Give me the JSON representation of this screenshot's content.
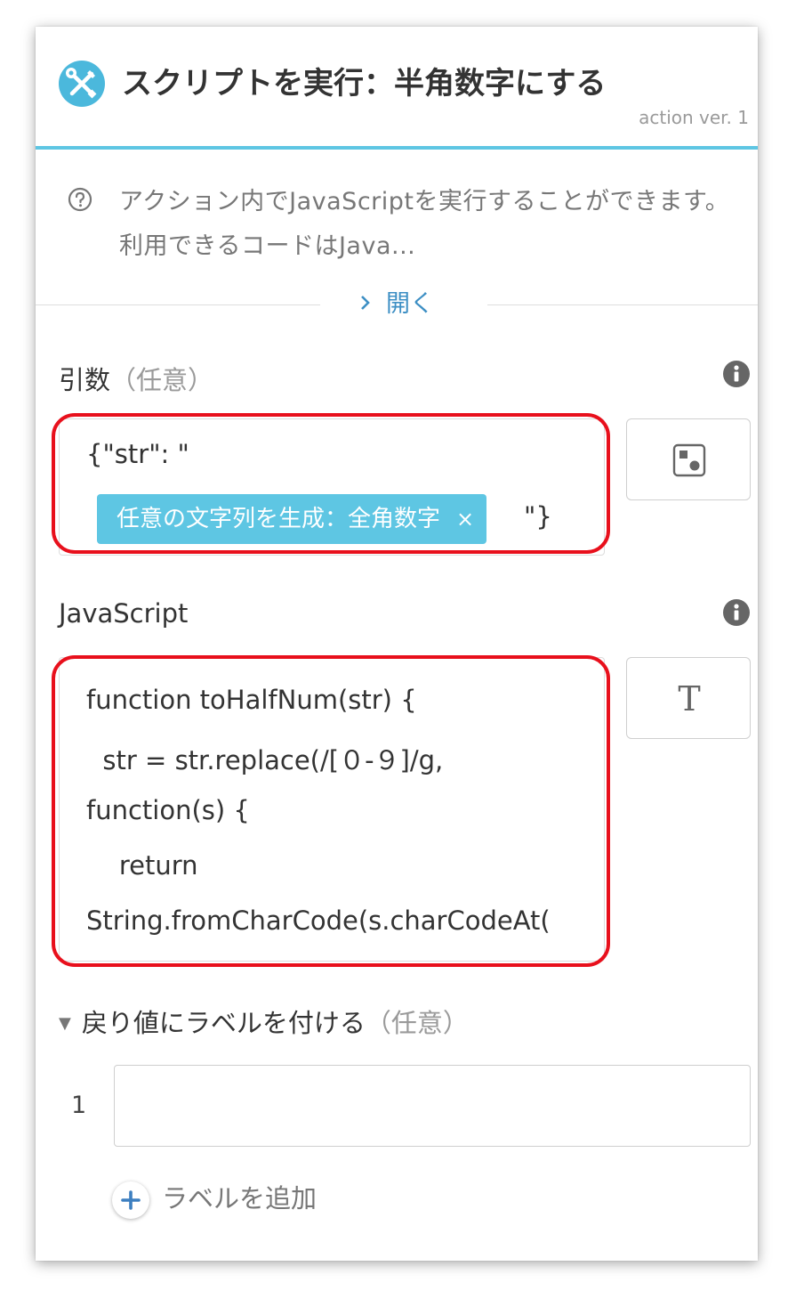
{
  "header": {
    "title": "スクリプトを実行：半角数字にする",
    "version": "action ver. 1",
    "icon": "tools-icon",
    "accent_color": "#5ec6e3"
  },
  "description": {
    "text": "アクション内でJavaScriptを実行することができます。利用できるコードはJava...",
    "icon": "help-circle-icon",
    "toggle_label": "開く",
    "toggle_icon": "chevron-right-icon"
  },
  "arguments": {
    "label": "引数",
    "optional": "（任意）",
    "value_prefix": "{\"str\": \"",
    "tag_label": "任意の文字列を生成：全角数字",
    "tag_close": "×",
    "value_suffix": "\"}",
    "side_button_icon": "variable-insert-icon",
    "info_icon": "info-icon"
  },
  "javascript": {
    "label": "JavaScript",
    "lines": [
      "function toHalfNum(str) {",
      "  str = str.replace(/[０-９]/g,",
      "function(s) {",
      "    return",
      "String.fromCharCode(s.charCodeAt("
    ],
    "side_button_label": "T",
    "info_icon": "info-icon"
  },
  "return_label": {
    "title": "戻り値にラベルを付ける",
    "optional": "（任意）",
    "expand_icon": "triangle-down-icon",
    "rows": [
      {
        "index": "1",
        "value": ""
      }
    ],
    "add_label": "ラベルを追加",
    "add_icon": "plus-icon"
  },
  "colors": {
    "highlight": "#e8101c",
    "tag_bg": "#5ec6e3",
    "link": "#3d8fc4"
  }
}
